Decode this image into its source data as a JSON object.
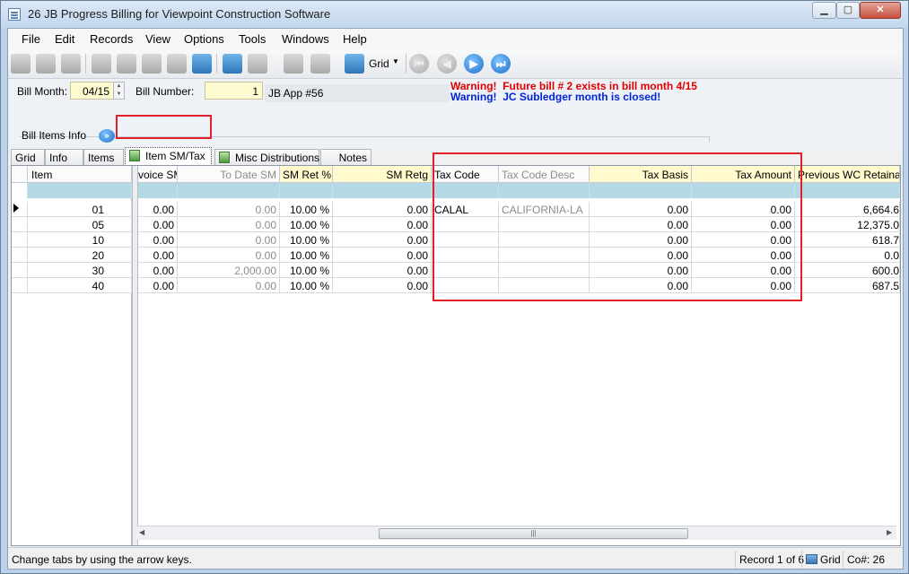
{
  "window": {
    "title": "26 JB Progress Billing for Viewpoint Construction Software",
    "min_label": "▁",
    "max_label": "▢",
    "close_label": "✕"
  },
  "menu": [
    "File",
    "Edit",
    "Records",
    "View",
    "Options",
    "Tools",
    "Windows",
    "Help"
  ],
  "toolbar": {
    "grid_label": "Grid",
    "icons": [
      "exit-icon",
      "find-icon",
      "lookup-icon",
      "new-icon",
      "save-icon",
      "delete-icon",
      "undo-icon",
      "refresh-icon",
      "calculator-icon",
      "attach-icon",
      "stamp-icon",
      "spellcheck-icon",
      "grid-icon"
    ],
    "nav_icons": [
      "first-record-icon",
      "previous-record-icon",
      "next-record-icon",
      "last-record-icon"
    ]
  },
  "header": {
    "bill_month_label": "Bill Month:",
    "bill_month_value": "04/15",
    "bill_number_label": "Bill Number:",
    "bill_number_value": "1",
    "bill_description": "JB App #56",
    "warning_1": "Warning!  Future bill # 2 exists in bill month 4/15",
    "warning_2": "Warning!  JC Subledger month is closed!"
  },
  "section": {
    "label": "Bill Items Info",
    "chevron": "»"
  },
  "tabs": [
    "Grid",
    "Info",
    "Items",
    "Item SM/Tax",
    "Misc Distributions",
    "Notes"
  ],
  "active_tab": "Item SM/Tax",
  "grid": {
    "left_header": "Item",
    "columns": [
      "voice SM",
      "To Date SM",
      "SM Ret %",
      "SM Retg",
      "Tax Code",
      "Tax Code Desc",
      "Tax Basis",
      "Tax Amount",
      "Previous WC Retainag"
    ],
    "rows": [
      {
        "item": "01",
        "invoice_sm": "0.00",
        "to_date_sm": "0.00",
        "sm_ret_pct": "10.00 %",
        "sm_retg": "0.00",
        "tax_code": "CALAL",
        "tax_code_desc": "CALIFORNIA-LA",
        "tax_basis": "0.00",
        "tax_amount": "0.00",
        "prev_wc_ret": "6,664.6"
      },
      {
        "item": "05",
        "invoice_sm": "0.00",
        "to_date_sm": "0.00",
        "sm_ret_pct": "10.00 %",
        "sm_retg": "0.00",
        "tax_code": "",
        "tax_code_desc": "",
        "tax_basis": "0.00",
        "tax_amount": "0.00",
        "prev_wc_ret": "12,375.0"
      },
      {
        "item": "10",
        "invoice_sm": "0.00",
        "to_date_sm": "0.00",
        "sm_ret_pct": "10.00 %",
        "sm_retg": "0.00",
        "tax_code": "",
        "tax_code_desc": "",
        "tax_basis": "0.00",
        "tax_amount": "0.00",
        "prev_wc_ret": "618.7"
      },
      {
        "item": "20",
        "invoice_sm": "0.00",
        "to_date_sm": "0.00",
        "sm_ret_pct": "10.00 %",
        "sm_retg": "0.00",
        "tax_code": "",
        "tax_code_desc": "",
        "tax_basis": "0.00",
        "tax_amount": "0.00",
        "prev_wc_ret": "0.0"
      },
      {
        "item": "30",
        "invoice_sm": "0.00",
        "to_date_sm": "2,000.00",
        "sm_ret_pct": "10.00 %",
        "sm_retg": "0.00",
        "tax_code": "",
        "tax_code_desc": "",
        "tax_basis": "0.00",
        "tax_amount": "0.00",
        "prev_wc_ret": "600.0"
      },
      {
        "item": "40",
        "invoice_sm": "0.00",
        "to_date_sm": "0.00",
        "sm_ret_pct": "10.00 %",
        "sm_retg": "0.00",
        "tax_code": "",
        "tax_code_desc": "",
        "tax_basis": "0.00",
        "tax_amount": "0.00",
        "prev_wc_ret": "687.5"
      }
    ]
  },
  "status": {
    "hint": "Change tabs by using the arrow keys.",
    "record": "Record 1 of 6",
    "view": "Grid",
    "company": "Co#: 26"
  },
  "colors": {
    "warning_red": "#e00000",
    "warning_blue": "#0026d9",
    "highlight_red": "#e1202a",
    "filter_row": "#b3d9e6",
    "yellow_field": "#fffbd1"
  }
}
